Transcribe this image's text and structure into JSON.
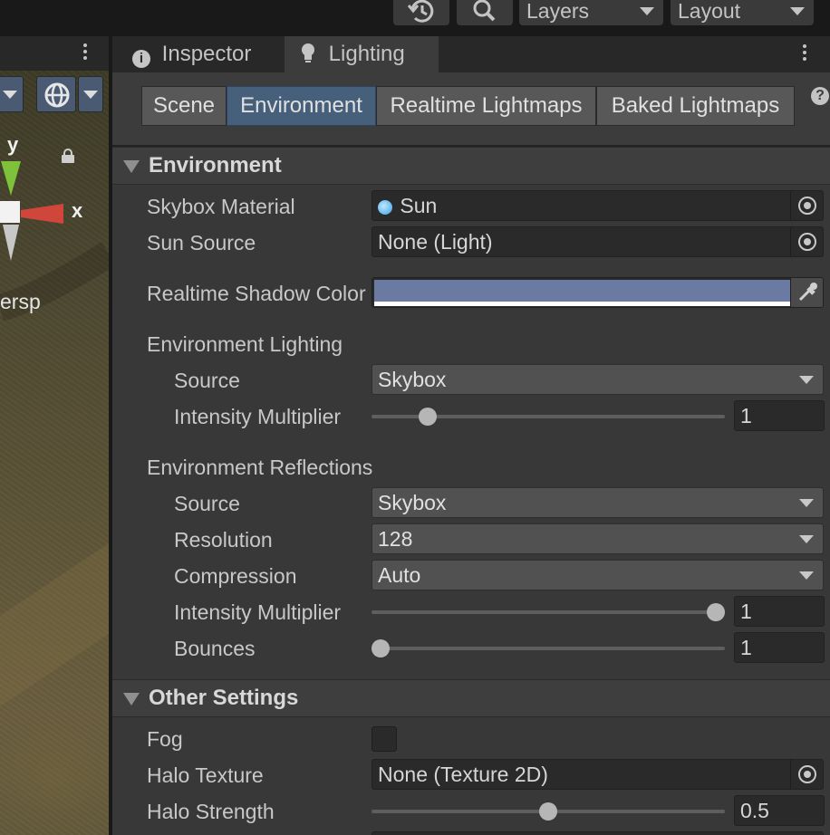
{
  "toolbar": {
    "layers_label": "Layers",
    "layout_label": "Layout"
  },
  "scene": {
    "axis_y": "y",
    "axis_x": "x",
    "perspective_label": "ersp"
  },
  "panel_tabs": [
    {
      "label": "Inspector",
      "icon": "info-icon"
    },
    {
      "label": "Lighting",
      "icon": "lightbulb-icon"
    }
  ],
  "subtabs": [
    "Scene",
    "Environment",
    "Realtime Lightmaps",
    "Baked Lightmaps"
  ],
  "active_subtab": "Environment",
  "environment": {
    "header": "Environment",
    "skybox_material_label": "Skybox Material",
    "skybox_material_value": "Sun",
    "sun_source_label": "Sun Source",
    "sun_source_value": "None (Light)",
    "shadow_color_label": "Realtime Shadow Color",
    "shadow_color": "#6b7aa3",
    "lighting_header": "Environment Lighting",
    "lighting_source_label": "Source",
    "lighting_source_value": "Skybox",
    "lighting_intensity_label": "Intensity Multiplier",
    "lighting_intensity_value": "1",
    "lighting_intensity_fraction": 0.14,
    "reflections_header": "Environment Reflections",
    "refl_source_label": "Source",
    "refl_source_value": "Skybox",
    "refl_resolution_label": "Resolution",
    "refl_resolution_value": "128",
    "refl_compression_label": "Compression",
    "refl_compression_value": "Auto",
    "refl_intensity_label": "Intensity Multiplier",
    "refl_intensity_value": "1",
    "refl_intensity_fraction": 1.0,
    "bounces_label": "Bounces",
    "bounces_value": "1",
    "bounces_fraction": 0.0
  },
  "other_settings": {
    "header": "Other Settings",
    "fog_label": "Fog",
    "fog_checked": false,
    "halo_texture_label": "Halo Texture",
    "halo_texture_value": "None (Texture 2D)",
    "halo_strength_label": "Halo Strength",
    "halo_strength_value": "0.5",
    "halo_strength_fraction": 0.5
  },
  "colors": {
    "accent_tab": "#46607c",
    "panel_bg": "#383838"
  }
}
